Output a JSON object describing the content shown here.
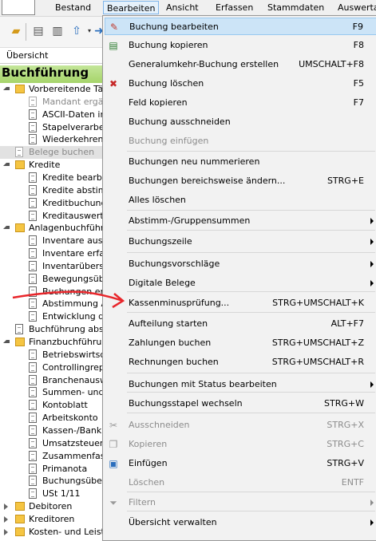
{
  "menubar": {
    "items": [
      "Bestand",
      "Bearbeiten",
      "Ansicht",
      "Erfassen",
      "Stammdaten",
      "Auswerta"
    ]
  },
  "overview_tab": "Übersicht",
  "header": "Buchführung",
  "tree": [
    {
      "label": "Vorbereitende Tätig",
      "type": "folder",
      "exp": true
    },
    {
      "label": "Mandant ergän",
      "type": "doc",
      "gray": true
    },
    {
      "label": "ASCII-Daten im",
      "type": "doc"
    },
    {
      "label": "Stapelverarbeit",
      "type": "doc"
    },
    {
      "label": "Wiederkehrend",
      "type": "doc"
    },
    {
      "label": "Belege buchen",
      "type": "doc",
      "gray": true,
      "selected": true
    },
    {
      "label": "Kredite",
      "type": "folder",
      "exp": true
    },
    {
      "label": "Kredite bearbeit",
      "type": "doc"
    },
    {
      "label": "Kredite abstimm",
      "type": "doc"
    },
    {
      "label": "Kreditbuchunge",
      "type": "doc"
    },
    {
      "label": "Kreditauswertun",
      "type": "doc"
    },
    {
      "label": "Anlagenbuchführun",
      "type": "folder",
      "exp": true
    },
    {
      "label": "Inventare aus E",
      "type": "doc"
    },
    {
      "label": "Inventare erfass",
      "type": "doc"
    },
    {
      "label": "Inventarübersic",
      "type": "doc"
    },
    {
      "label": "Bewegungsübe",
      "type": "doc"
    },
    {
      "label": "Buchungen erz",
      "type": "doc"
    },
    {
      "label": "Abstimmung An",
      "type": "doc"
    },
    {
      "label": "Entwicklung de",
      "type": "doc"
    },
    {
      "label": "Buchführung abstin",
      "type": "doc"
    },
    {
      "label": "Finanzbuchführung",
      "type": "folder",
      "exp": true
    },
    {
      "label": "Betriebswirtscha",
      "type": "doc"
    },
    {
      "label": "Controllingrepor",
      "type": "doc"
    },
    {
      "label": "Branchenauswe",
      "type": "doc"
    },
    {
      "label": "Summen- und S",
      "type": "doc"
    },
    {
      "label": "Kontoblatt",
      "type": "doc"
    },
    {
      "label": "Arbeitskonto",
      "type": "doc"
    },
    {
      "label": "Kassen-/Bankb",
      "type": "doc"
    },
    {
      "label": "Umsatzsteuer-V",
      "type": "doc"
    },
    {
      "label": "Zusammenfassu",
      "type": "doc"
    },
    {
      "label": "Primanota",
      "type": "doc"
    },
    {
      "label": "Buchungsübers",
      "type": "doc"
    },
    {
      "label": "USt 1/11",
      "type": "doc"
    },
    {
      "label": "Debitoren",
      "type": "folder",
      "exp": false
    },
    {
      "label": "Kreditoren",
      "type": "folder",
      "exp": false
    },
    {
      "label": "Kosten- und Leistu",
      "type": "folder",
      "exp": false
    }
  ],
  "menu": [
    {
      "label": "Buchung bearbeiten",
      "shortcut": "F9",
      "icon": "edit-icon",
      "highlight": true
    },
    {
      "label": "Buchung kopieren",
      "shortcut": "F8",
      "icon": "copy-booking-icon"
    },
    {
      "label": "Generalumkehr-Buchung erstellen",
      "shortcut": "UMSCHALT+F8"
    },
    {
      "label": "Buchung löschen",
      "shortcut": "F5",
      "icon": "delete-booking-icon"
    },
    {
      "label": "Feld kopieren",
      "shortcut": "F7"
    },
    {
      "label": "Buchung ausschneiden",
      "shortcut": ""
    },
    {
      "label": "Buchung einfügen",
      "shortcut": "",
      "disabled": true
    },
    {
      "sep": true
    },
    {
      "label": "Buchungen neu nummerieren",
      "shortcut": ""
    },
    {
      "label": "Buchungen bereichsweise ändern...",
      "shortcut": "STRG+E"
    },
    {
      "label": "Alles löschen",
      "shortcut": ""
    },
    {
      "sep": true
    },
    {
      "label": "Abstimm-/Gruppensummen",
      "submenu": true
    },
    {
      "sep": true
    },
    {
      "label": "Buchungszeile",
      "submenu": true
    },
    {
      "sep": true
    },
    {
      "label": "Buchungsvorschläge",
      "submenu": true
    },
    {
      "label": "Digitale Belege",
      "submenu": true
    },
    {
      "sep": true
    },
    {
      "label": "Kassenminusprüfung...",
      "shortcut": "STRG+UMSCHALT+K"
    },
    {
      "sep": true
    },
    {
      "label": "Aufteilung starten",
      "shortcut": "ALT+F7"
    },
    {
      "label": "Zahlungen buchen",
      "shortcut": "STRG+UMSCHALT+Z"
    },
    {
      "label": "Rechnungen buchen",
      "shortcut": "STRG+UMSCHALT+R"
    },
    {
      "sep": true
    },
    {
      "label": "Buchungen mit Status bearbeiten",
      "submenu": true
    },
    {
      "sep": true
    },
    {
      "label": "Buchungsstapel wechseln",
      "shortcut": "STRG+W"
    },
    {
      "sep": true
    },
    {
      "label": "Ausschneiden",
      "shortcut": "STRG+X",
      "disabled": true,
      "icon": "scissors-icon"
    },
    {
      "label": "Kopieren",
      "shortcut": "STRG+C",
      "disabled": true,
      "icon": "copy-icon"
    },
    {
      "label": "Einfügen",
      "shortcut": "STRG+V",
      "icon": "paste-icon"
    },
    {
      "label": "Löschen",
      "shortcut": "ENTF",
      "disabled": true
    },
    {
      "sep": true
    },
    {
      "label": "Filtern",
      "submenu": true,
      "disabled": true,
      "icon": "filter-icon"
    },
    {
      "sep": true
    },
    {
      "label": "Übersicht verwalten",
      "submenu": true
    }
  ],
  "colors": {
    "annotation_arrow": "#e8262b",
    "header_green": "#a6d46a",
    "menu_highlight": "#cce4f7"
  }
}
